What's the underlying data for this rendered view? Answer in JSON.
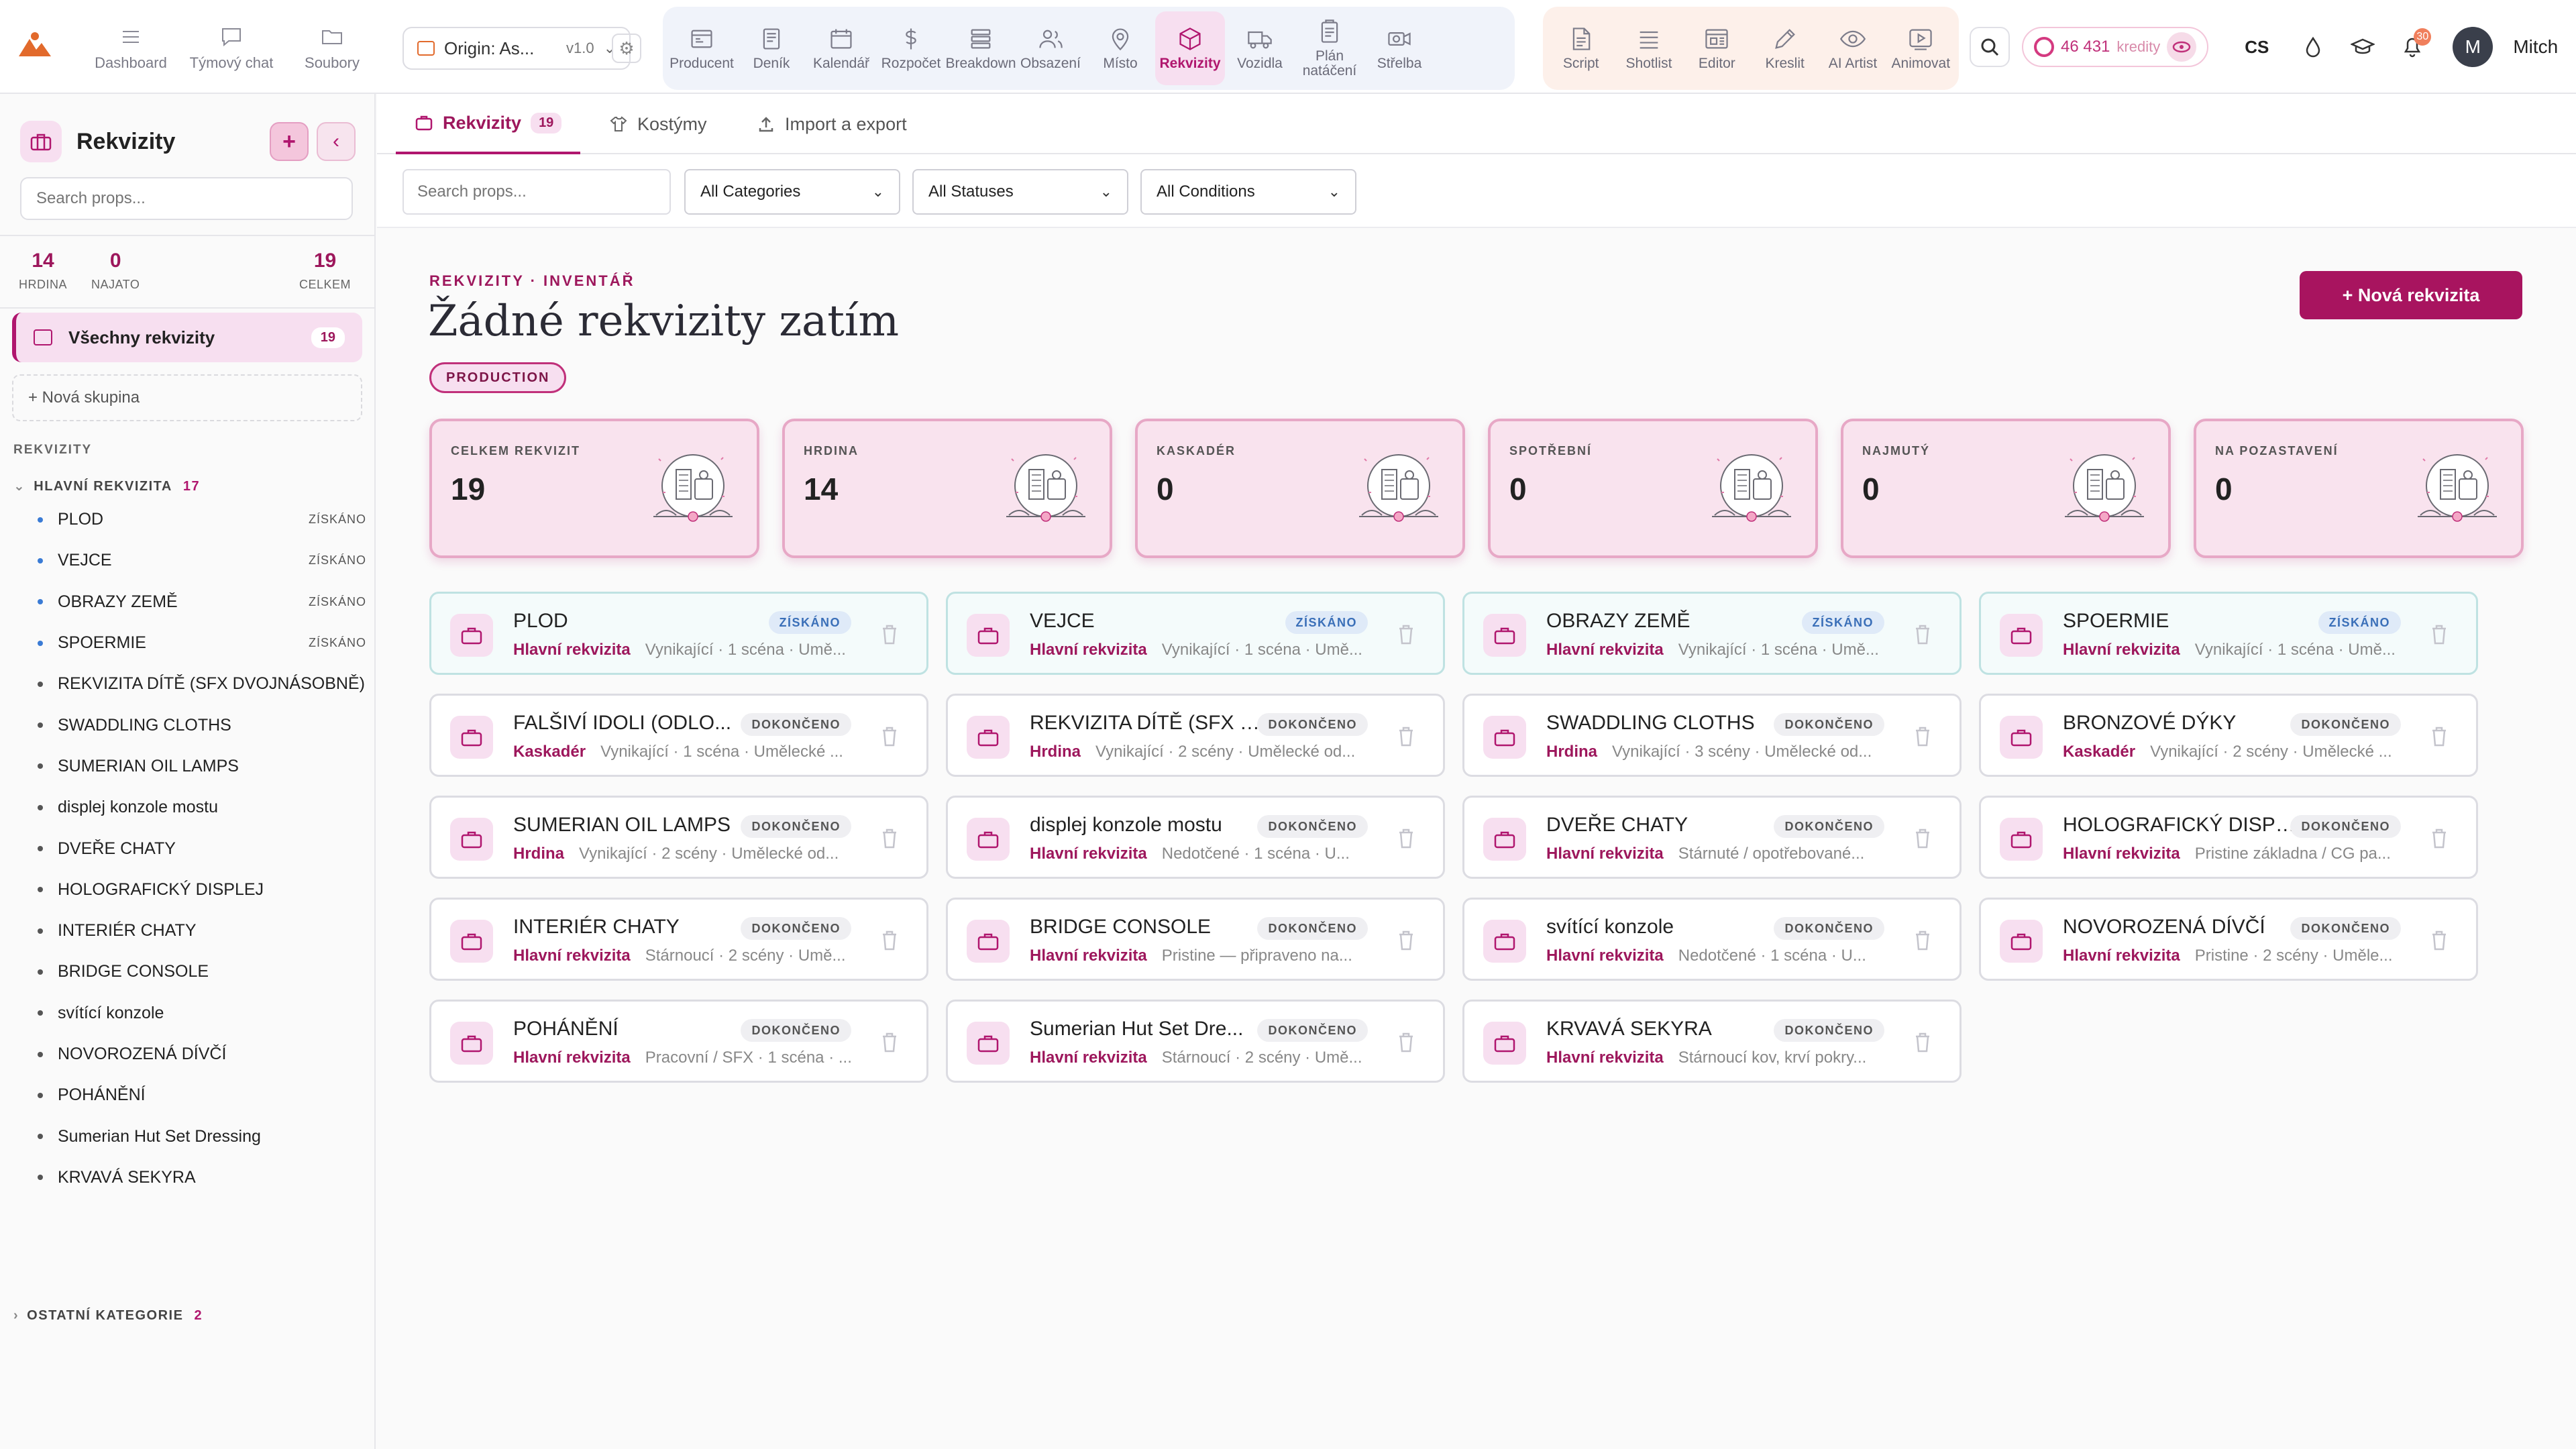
{
  "topnav": {
    "left": [
      {
        "label": "Dashboard",
        "icon": "menu-icon"
      },
      {
        "label": "Týmový chat",
        "icon": "chat-icon"
      },
      {
        "label": "Soubory",
        "icon": "folder-icon"
      }
    ],
    "origin": {
      "project": "Origin: As...",
      "version": "v1.0"
    },
    "tools_main": [
      {
        "label": "Producent",
        "icon": "producer-icon",
        "active": false
      },
      {
        "label": "Deník",
        "icon": "journal-icon",
        "active": false
      },
      {
        "label": "Kalendář",
        "icon": "calendar-icon",
        "active": false
      },
      {
        "label": "Rozpočet",
        "icon": "dollar-icon",
        "active": false
      },
      {
        "label": "Breakdown",
        "icon": "stack-icon",
        "active": false
      },
      {
        "label": "Obsazení",
        "icon": "people-icon",
        "active": false
      },
      {
        "label": "Místo",
        "icon": "map-pin-icon",
        "active": false
      },
      {
        "label": "Rekvizity",
        "icon": "box-icon",
        "active": true
      },
      {
        "label": "Vozidla",
        "icon": "truck-icon",
        "active": false
      },
      {
        "label": "Plán natáčení",
        "icon": "clipboard-icon",
        "active": false
      },
      {
        "label": "Střelba",
        "icon": "camera-icon",
        "active": false
      }
    ],
    "tools_create": [
      {
        "label": "Script",
        "icon": "script-icon"
      },
      {
        "label": "Shotlist",
        "icon": "list-icon"
      },
      {
        "label": "Editor",
        "icon": "editor-icon"
      },
      {
        "label": "Kreslit",
        "icon": "pen-icon"
      },
      {
        "label": "AI Artist",
        "icon": "eye-icon"
      },
      {
        "label": "Animovat",
        "icon": "play-icon"
      }
    ],
    "credits_value": "46 431",
    "credits_label": "kredity",
    "language": "CS",
    "notifications": "30",
    "user_initial": "M",
    "user_name": "Mitch"
  },
  "sidebar": {
    "title": "Rekvizity",
    "search_placeholder": "Search props...",
    "stats": [
      {
        "value": "14",
        "label": "HRDINA"
      },
      {
        "value": "0",
        "label": "NAJATO"
      },
      {
        "value": "19",
        "label": "CELKEM"
      }
    ],
    "all_label": "Všechny rekvizity",
    "all_count": "19",
    "new_group": "+ Nová skupina",
    "section": "REKVIZITY",
    "category": "HLAVNÍ REKVIZITA",
    "category_count": "17",
    "items": [
      {
        "name": "PLOD",
        "status": "ZÍSKÁNO"
      },
      {
        "name": "VEJCE",
        "status": "ZÍSKÁNO"
      },
      {
        "name": "OBRAZY ZEMĚ",
        "status": "ZÍSKÁNO"
      },
      {
        "name": "SPOERMIE",
        "status": "ZÍSKÁNO"
      },
      {
        "name": "REKVIZITA DÍTĚ (SFX DVOJNÁSOBNĚ)",
        "status": ""
      },
      {
        "name": "SWADDLING CLOTHS",
        "status": ""
      },
      {
        "name": "SUMERIAN OIL LAMPS",
        "status": ""
      },
      {
        "name": "displej konzole mostu",
        "status": ""
      },
      {
        "name": "DVEŘE CHATY",
        "status": ""
      },
      {
        "name": "HOLOGRAFICKÝ DISPLEJ",
        "status": ""
      },
      {
        "name": "INTERIÉR CHATY",
        "status": ""
      },
      {
        "name": "BRIDGE CONSOLE",
        "status": ""
      },
      {
        "name": "svítící konzole",
        "status": ""
      },
      {
        "name": "NOVOROZENÁ DÍVČÍ",
        "status": ""
      },
      {
        "name": "POHÁNĚNÍ",
        "status": ""
      },
      {
        "name": "Sumerian Hut Set Dressing",
        "status": ""
      },
      {
        "name": "KRVAVÁ SEKYRA",
        "status": ""
      }
    ],
    "other_category": "OSTATNÍ KATEGORIE",
    "other_count": "2"
  },
  "tabs": [
    {
      "label": "Rekvizity",
      "count": "19",
      "active": true
    },
    {
      "label": "Kostýmy",
      "count": "",
      "active": false
    },
    {
      "label": "Import a export",
      "count": "",
      "active": false
    }
  ],
  "filters": {
    "search_placeholder": "Search props...",
    "category": "All Categories",
    "status": "All Statuses",
    "condition": "All Conditions"
  },
  "header": {
    "eyebrow": "REKVIZITY · INVENTÁŘ",
    "title": "Žádné rekvizity zatím",
    "badge": "PRODUCTION",
    "new_button": "+ Nová rekvizita"
  },
  "stat_cards": [
    {
      "label": "CELKEM REKVIZIT",
      "value": "19"
    },
    {
      "label": "HRDINA",
      "value": "14"
    },
    {
      "label": "KASKADÉR",
      "value": "0"
    },
    {
      "label": "SPOTŘEBNÍ",
      "value": "0"
    },
    {
      "label": "NAJMUTÝ",
      "value": "0"
    },
    {
      "label": "NA POZASTAVENÍ",
      "value": "0"
    }
  ],
  "props": [
    {
      "name": "PLOD",
      "status": "ZÍSKÁNO",
      "category": "Hlavní rekvizita",
      "details": "Vynikající · 1 scéna · Umě..."
    },
    {
      "name": "VEJCE",
      "status": "ZÍSKÁNO",
      "category": "Hlavní rekvizita",
      "details": "Vynikající · 1 scéna · Umě..."
    },
    {
      "name": "OBRAZY ZEMĚ",
      "status": "ZÍSKÁNO",
      "category": "Hlavní rekvizita",
      "details": "Vynikající · 1 scéna · Umě..."
    },
    {
      "name": "SPOERMIE",
      "status": "ZÍSKÁNO",
      "category": "Hlavní rekvizita",
      "details": "Vynikající · 1 scéna · Umě..."
    },
    {
      "name": "FALŠIVÍ IDOLI (ODLO...",
      "status": "DOKONČENO",
      "category": "Kaskadér",
      "details": "Vynikající · 1 scéna · Umělecké ..."
    },
    {
      "name": "REKVIZITA DÍTĚ (SFX D...",
      "status": "DOKONČENO",
      "category": "Hrdina",
      "details": "Vynikající · 2 scény · Umělecké od..."
    },
    {
      "name": "SWADDLING CLOTHS",
      "status": "DOKONČENO",
      "category": "Hrdina",
      "details": "Vynikající · 3 scény · Umělecké od..."
    },
    {
      "name": "BRONZOVÉ DÝKY",
      "status": "DOKONČENO",
      "category": "Kaskadér",
      "details": "Vynikající · 2 scény · Umělecké ..."
    },
    {
      "name": "SUMERIAN OIL LAMPS",
      "status": "DOKONČENO",
      "category": "Hrdina",
      "details": "Vynikající · 2 scény · Umělecké od..."
    },
    {
      "name": "displej konzole mostu",
      "status": "DOKONČENO",
      "category": "Hlavní rekvizita",
      "details": "Nedotčené · 1 scéna · U..."
    },
    {
      "name": "DVEŘE CHATY",
      "status": "DOKONČENO",
      "category": "Hlavní rekvizita",
      "details": "Stárnuté / opotřebované..."
    },
    {
      "name": "HOLOGRAFICKÝ DISPL...",
      "status": "DOKONČENO",
      "category": "Hlavní rekvizita",
      "details": "Pristine základna / CG pa..."
    },
    {
      "name": "INTERIÉR CHATY",
      "status": "DOKONČENO",
      "category": "Hlavní rekvizita",
      "details": "Stárnoucí · 2 scény · Umě..."
    },
    {
      "name": "BRIDGE CONSOLE",
      "status": "DOKONČENO",
      "category": "Hlavní rekvizita",
      "details": "Pristine — připraveno na..."
    },
    {
      "name": "svítící konzole",
      "status": "DOKONČENO",
      "category": "Hlavní rekvizita",
      "details": "Nedotčené · 1 scéna · U..."
    },
    {
      "name": "NOVOROZENÁ DÍVČÍ",
      "status": "DOKONČENO",
      "category": "Hlavní rekvizita",
      "details": "Pristine · 2 scény · Uměle..."
    },
    {
      "name": "POHÁNĚNÍ",
      "status": "DOKONČENO",
      "category": "Hlavní rekvizita",
      "details": "Pracovní / SFX · 1 scéna · ..."
    },
    {
      "name": "Sumerian Hut Set Dre...",
      "status": "DOKONČENO",
      "category": "Hlavní rekvizita",
      "details": "Stárnoucí · 2 scény · Umě..."
    },
    {
      "name": "KRVAVÁ SEKYRA",
      "status": "DOKONČENO",
      "category": "Hlavní rekvizita",
      "details": "Stárnoucí kov, krví pokry..."
    }
  ],
  "colors": {
    "accent": "#b0166e",
    "accent_soft": "#f7dff0",
    "acquired": "#3a6fb8"
  }
}
